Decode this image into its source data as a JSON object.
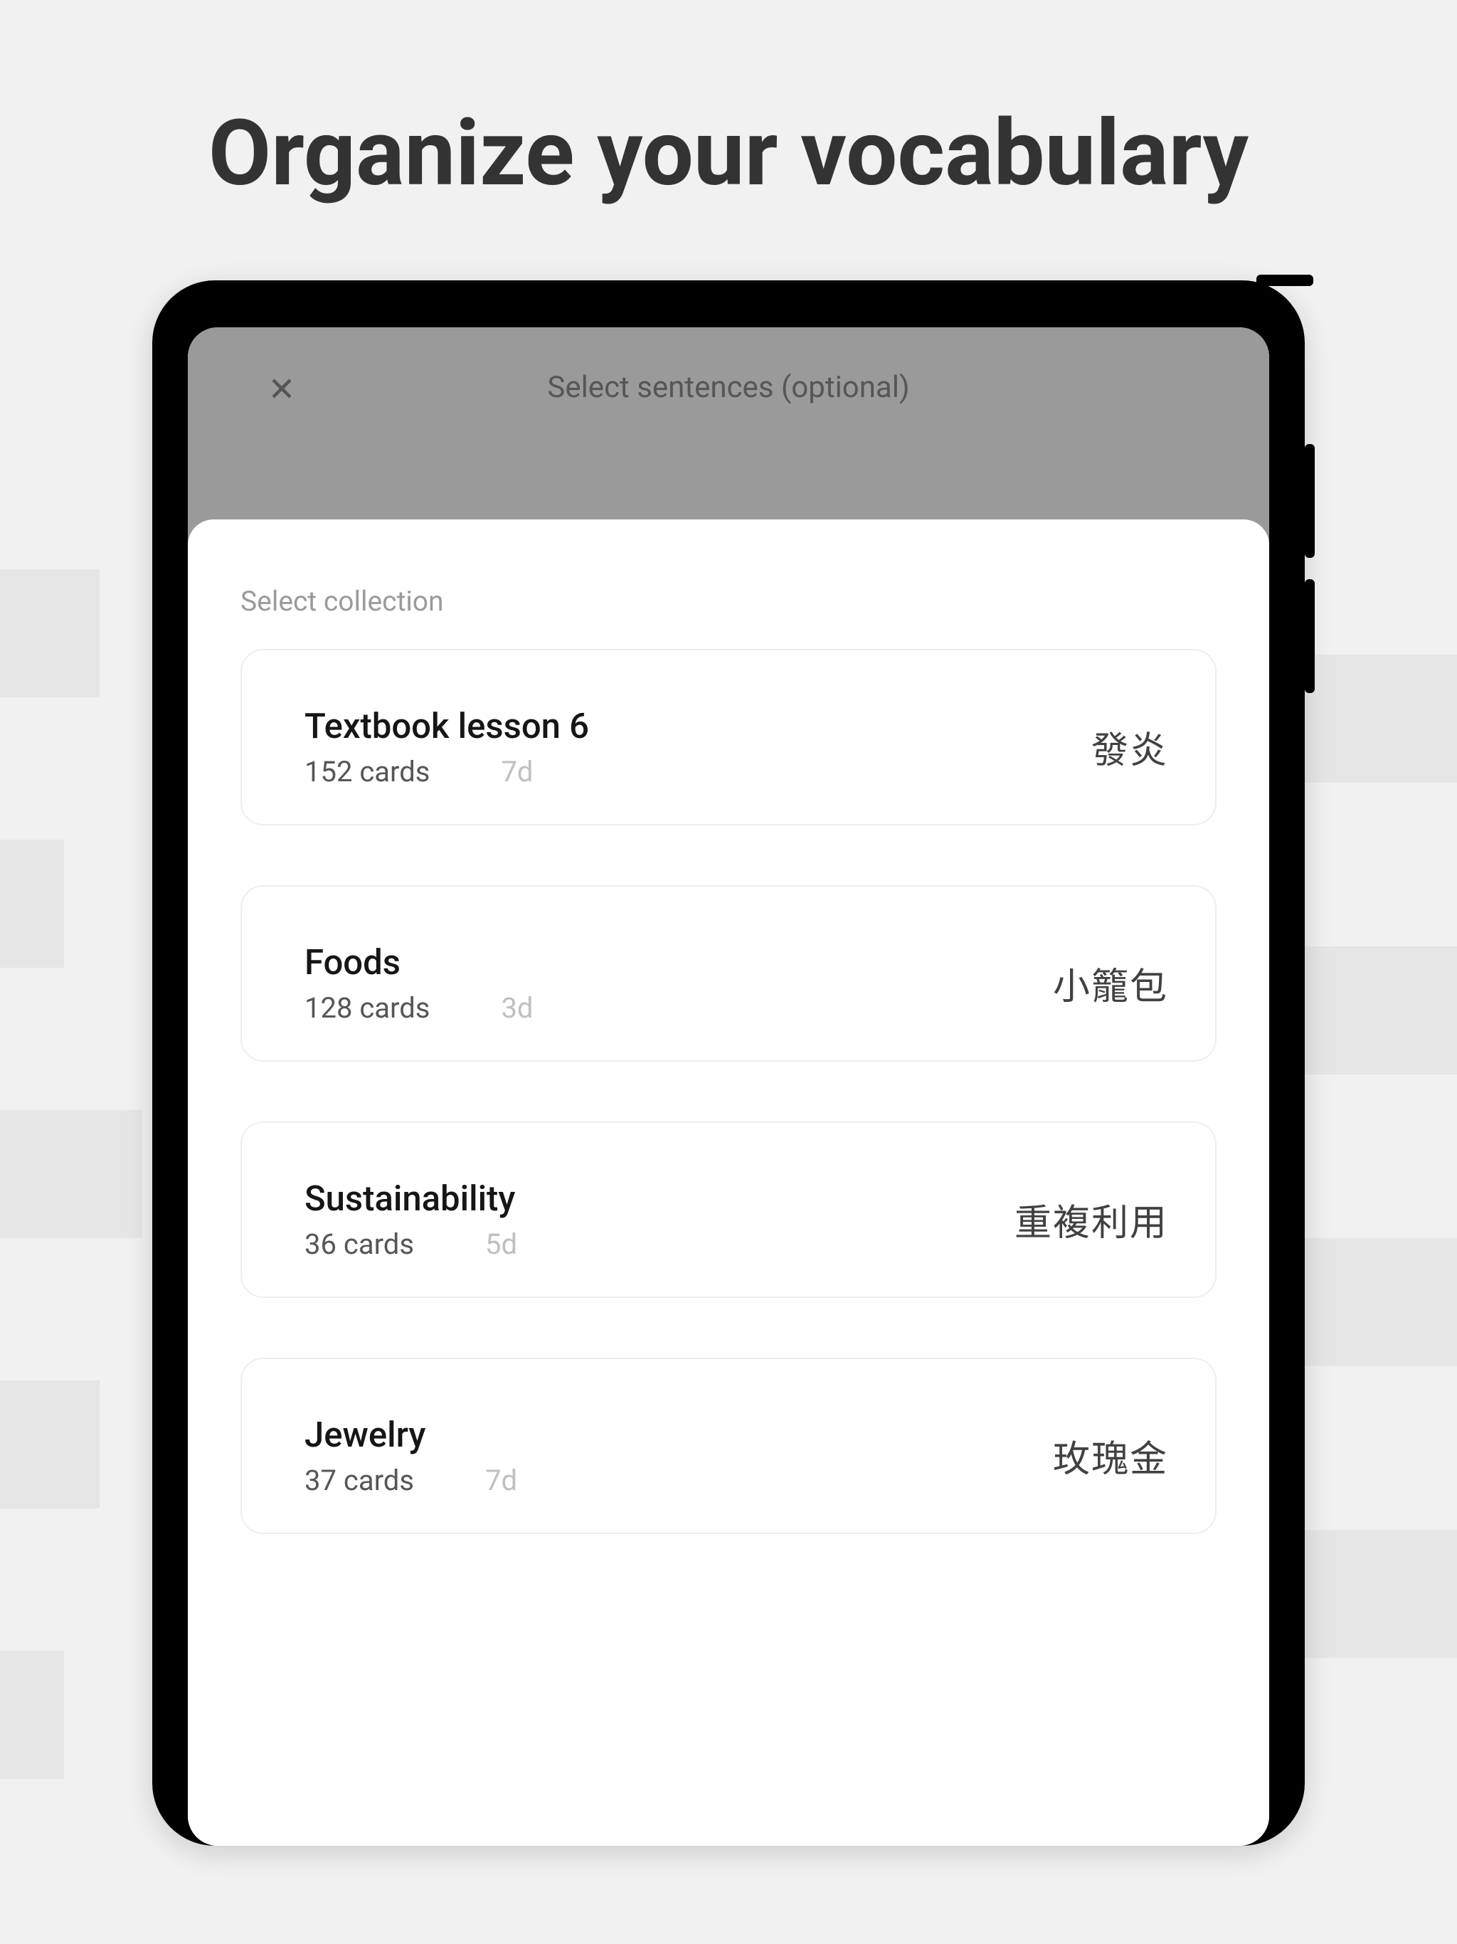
{
  "headline": "Organize your vocabulary",
  "modal": {
    "header_title": "Select sentences (optional)"
  },
  "sheet": {
    "label": "Select collection"
  },
  "collections": [
    {
      "title": "Textbook lesson 6",
      "cards": "152 cards",
      "time": "7d",
      "example": "發炎"
    },
    {
      "title": "Foods",
      "cards": "128 cards",
      "time": "3d",
      "example": "小籠包"
    },
    {
      "title": "Sustainability",
      "cards": "36 cards",
      "time": "5d",
      "example": "重複利用"
    },
    {
      "title": "Jewelry",
      "cards": "37 cards",
      "time": "7d",
      "example": "玫瑰金"
    }
  ]
}
